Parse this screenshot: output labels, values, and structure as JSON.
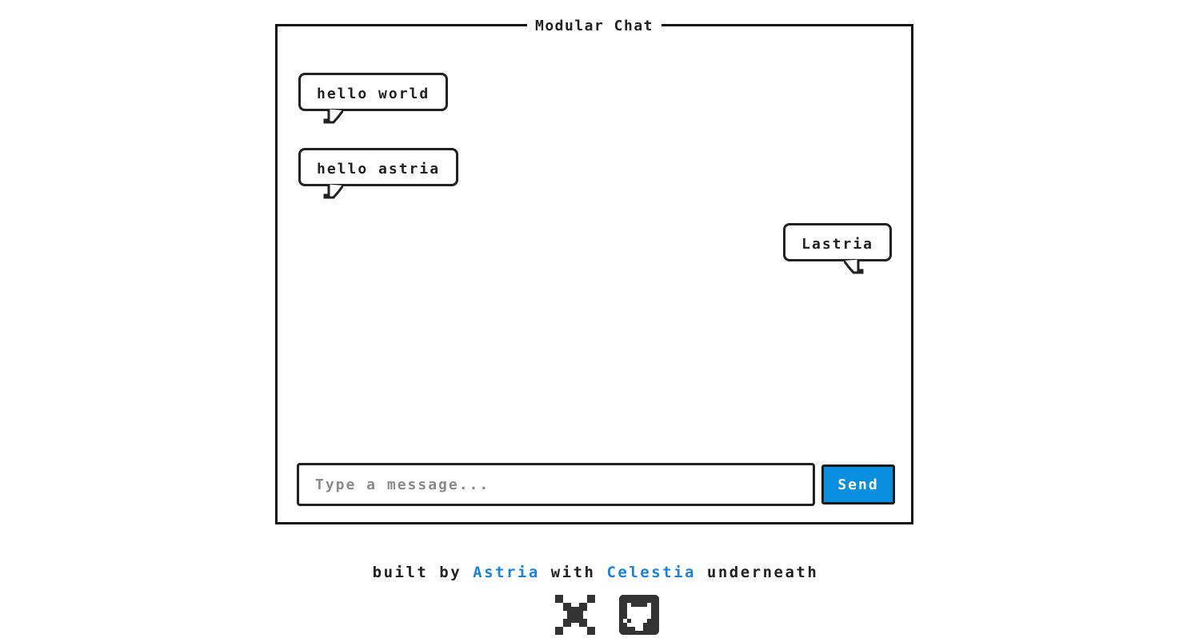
{
  "chat": {
    "title": "Modular Chat",
    "messages": [
      {
        "text": "hello world",
        "side": "left"
      },
      {
        "text": "hello astria",
        "side": "left"
      },
      {
        "text": "Lastria",
        "side": "right"
      }
    ]
  },
  "composer": {
    "placeholder": "Type a message...",
    "value": "",
    "send_label": "Send"
  },
  "footer": {
    "prefix": "built by",
    "author": "Astria",
    "middle": "with",
    "tech": "Celestia",
    "suffix": "underneath",
    "icons": [
      "x-icon",
      "github-icon"
    ]
  },
  "colors": {
    "accent": "#0a8fe0",
    "link": "#1a82e0",
    "ink": "#222222",
    "background": "#ffffff"
  }
}
